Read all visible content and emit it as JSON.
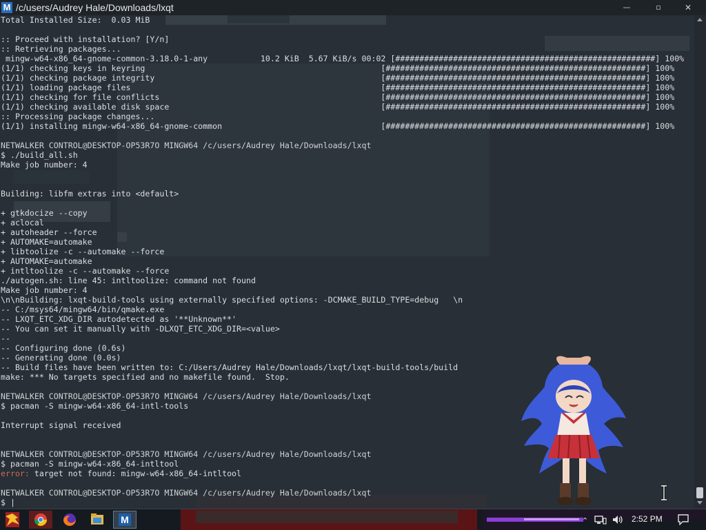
{
  "window": {
    "title": "/c/users/Audrey Hale/Downloads/lxqt",
    "app_icon_letter": "M",
    "controls": {
      "minimize": "—",
      "maximize": "▫",
      "close": "✕"
    }
  },
  "terminal": {
    "lines": [
      {
        "text": "Total Installed Size:  0.03 MiB"
      },
      {
        "text": ""
      },
      {
        "text": ":: Proceed with installation? [Y/n]"
      },
      {
        "text": ":: Retrieving packages..."
      },
      {
        "text": " mingw-w64-x86_64-gnome-common-3.18.0-1-any           10.2 KiB  5.67 KiB/s 00:02 [######################################################] 100%"
      },
      {
        "text": "(1/1) checking keys in keyring                                                 [######################################################] 100%"
      },
      {
        "text": "(1/1) checking package integrity                                               [######################################################] 100%"
      },
      {
        "text": "(1/1) loading package files                                                    [######################################################] 100%"
      },
      {
        "text": "(1/1) checking for file conflicts                                              [######################################################] 100%"
      },
      {
        "text": "(1/1) checking available disk space                                            [######################################################] 100%"
      },
      {
        "text": ":: Processing package changes..."
      },
      {
        "text": "(1/1) installing mingw-w64-x86_64-gnome-common                                 [######################################################] 100%"
      },
      {
        "text": ""
      },
      {
        "text": "NETWALKER CONTROL@DESKTOP-OP53R7O MINGW64 /c/users/Audrey Hale/Downloads/lxqt",
        "kind": "prompt"
      },
      {
        "text": "$ ./build_all.sh"
      },
      {
        "text": "Make job number: 4"
      },
      {
        "text": ""
      },
      {
        "text": ""
      },
      {
        "text": "Building: libfm extras into <default>"
      },
      {
        "text": ""
      },
      {
        "text": "+ gtkdocize --copy"
      },
      {
        "text": "+ aclocal"
      },
      {
        "text": "+ autoheader --force"
      },
      {
        "text": "+ AUTOMAKE=automake"
      },
      {
        "text": "+ libtoolize -c --automake --force"
      },
      {
        "text": "+ AUTOMAKE=automake"
      },
      {
        "text": "+ intltoolize -c --automake --force"
      },
      {
        "text": "./autogen.sh: line 45: intltoolize: command not found"
      },
      {
        "text": "Make job number: 4"
      },
      {
        "text": "\\n\\nBuilding: lxqt-build-tools using externally specified options: -DCMAKE_BUILD_TYPE=debug   \\n"
      },
      {
        "text": "-- C:/msys64/mingw64/bin/qmake.exe"
      },
      {
        "text": "-- LXQT_ETC_XDG_DIR autodetected as '**Unknown**'"
      },
      {
        "text": "-- You can set it manually with -DLXQT_ETC_XDG_DIR=<value>"
      },
      {
        "text": "--"
      },
      {
        "text": "-- Configuring done (0.6s)"
      },
      {
        "text": "-- Generating done (0.0s)"
      },
      {
        "text": "-- Build files have been written to: C:/Users/Audrey Hale/Downloads/lxqt/lxqt-build-tools/build"
      },
      {
        "text": "make: *** No targets specified and no makefile found.  Stop."
      },
      {
        "text": ""
      },
      {
        "text": "NETWALKER CONTROL@DESKTOP-OP53R7O MINGW64 /c/users/Audrey Hale/Downloads/lxqt",
        "kind": "prompt"
      },
      {
        "text": "$ pacman -S mingw-w64-x86_64-intl-tools"
      },
      {
        "text": ""
      },
      {
        "text": "Interrupt signal received"
      },
      {
        "text": ""
      },
      {
        "text": ""
      },
      {
        "text": "NETWALKER CONTROL@DESKTOP-OP53R7O MINGW64 /c/users/Audrey Hale/Downloads/lxqt",
        "kind": "prompt"
      },
      {
        "text": "$ pacman -S mingw-w64-x86_64-intltool"
      },
      {
        "segments": [
          {
            "text": "error:",
            "kind": "err"
          },
          {
            "text": " target not found: mingw-w64-x86_64-intltool"
          }
        ]
      },
      {
        "text": ""
      },
      {
        "text": "NETWALKER CONTROL@DESKTOP-OP53R7O MINGW64 /c/users/Audrey Hale/Downloads/lxqt",
        "kind": "prompt"
      },
      {
        "text": "$ |"
      }
    ]
  },
  "taskbar": {
    "items": [
      {
        "name": "start-button",
        "icon": "start-icon"
      },
      {
        "name": "chrome-task",
        "icon": "chrome-icon"
      },
      {
        "name": "firefox-task",
        "icon": "firefox-icon"
      },
      {
        "name": "explorer-task",
        "icon": "folder-icon"
      },
      {
        "name": "terminal-task",
        "icon": "msys-terminal-icon",
        "letter": "M"
      }
    ],
    "tray": {
      "chevron": "⌃",
      "clock": "2:52 PM"
    }
  },
  "colors": {
    "terminal_bg": "#2b323a",
    "terminal_fg": "#dcdfe2",
    "error": "#d26a5e",
    "taskbar_bg": "#141a20",
    "taskbar_accent": "#8a3fd6"
  }
}
